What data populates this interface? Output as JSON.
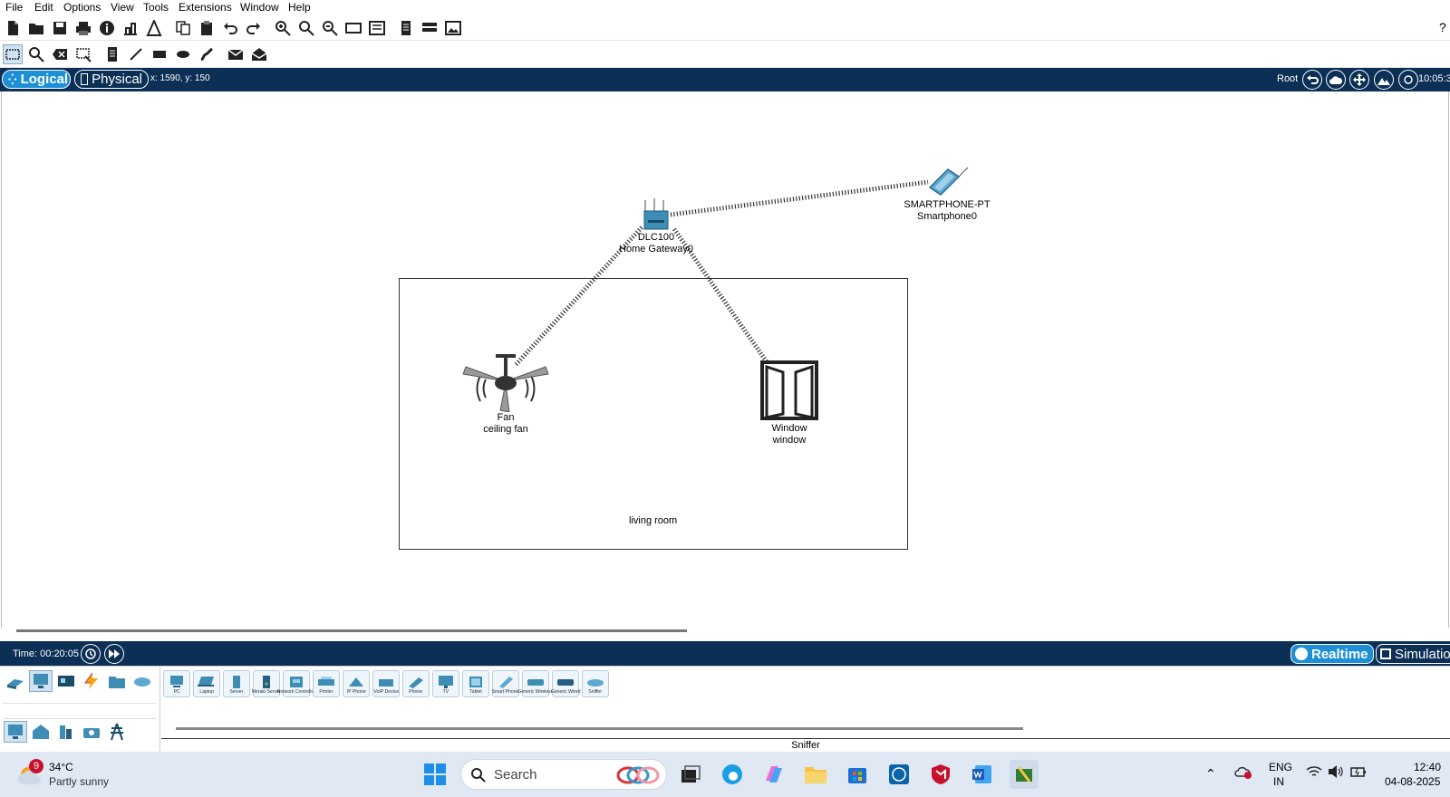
{
  "menu": [
    "File",
    "Edit",
    "Options",
    "View",
    "Tools",
    "Extensions",
    "Window",
    "Help"
  ],
  "toolbar1": [
    "new-icon",
    "open-icon",
    "save-icon",
    "print-icon",
    "info-icon",
    "network-wizard-icon",
    "activity-wizard-icon",
    "copy-icon",
    "paste-icon",
    "undo-icon",
    "redo-icon",
    "zoom-in-icon",
    "zoom-reset-icon",
    "zoom-out-icon",
    "drawing-palette-icon",
    "custom-device-icon",
    "cluster-icon",
    "viewport-icon",
    "screenshot-icon"
  ],
  "toolbar2": [
    "select-icon",
    "inspect-icon",
    "delete-icon",
    "resize-shape-icon",
    "note-icon",
    "line-icon",
    "rectangle-icon",
    "ellipse-icon",
    "freeform-icon",
    "simple-pdu-icon",
    "complex-pdu-icon"
  ],
  "nav": {
    "logical": "Logical",
    "physical": "Physical",
    "coords": "x: 1590, y: 150",
    "root": "Root",
    "clock": "10:05:3"
  },
  "devices": {
    "gateway": {
      "model": "DLC100",
      "name": "Home Gateway0"
    },
    "phone": {
      "model": "SMARTPHONE-PT",
      "name": "Smartphone0"
    },
    "fan": {
      "model": "Fan",
      "name": "ceiling fan"
    },
    "window": {
      "model": "Window",
      "name": "window"
    }
  },
  "cluster": {
    "label": "living room"
  },
  "bottom": {
    "time": "Time: 00:20:05",
    "realtime": "Realtime",
    "simulation": "Simulatio"
  },
  "device_types": [
    "PC",
    "Laptop",
    "Server",
    "Meraki Server",
    "Network Controller",
    "Printer",
    "IP Phone",
    "VoIP Device",
    "Phone",
    "TV",
    "Tablet",
    "Smart Phone",
    "Generic Wireless",
    "Generic Wired",
    "Sniffer"
  ],
  "selected_device_label": "Sniffer",
  "taskbar": {
    "badge": "9",
    "temp": "34°C",
    "weather": "Partly sunny",
    "search": "Search",
    "lang1": "ENG",
    "lang2": "IN",
    "time": "12:40",
    "date": "04-08-2025"
  },
  "colors": {
    "nav": "#0b2f55",
    "accent": "#1c8fd6",
    "device": "#3f8db5"
  }
}
